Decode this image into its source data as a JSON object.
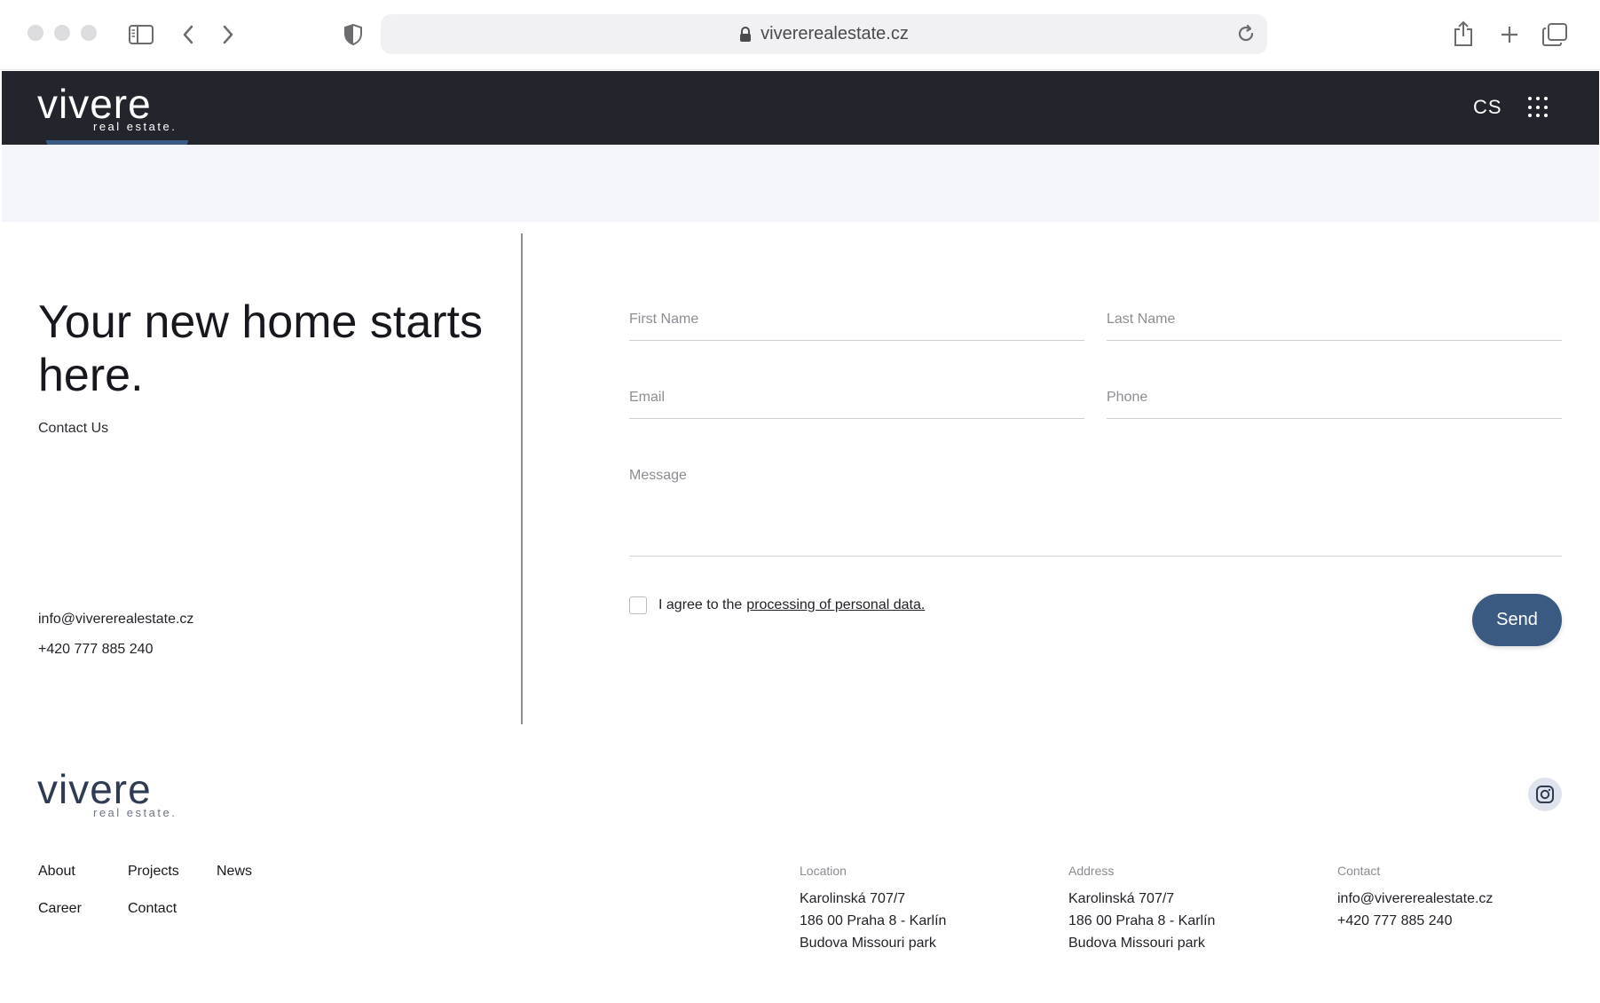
{
  "browser": {
    "url": "vivererealestate.cz"
  },
  "header": {
    "logo_main": "vivere",
    "logo_sub": "real estate.",
    "language": "CS"
  },
  "contact": {
    "headline": "Your new home starts here.",
    "subhead": "Contact Us",
    "email": "info@vivererealestate.cz",
    "phone": "+420 777 885 240"
  },
  "form": {
    "first_name_placeholder": "First Name",
    "last_name_placeholder": "Last Name",
    "email_placeholder": "Email",
    "phone_placeholder": "Phone",
    "message_placeholder": "Message",
    "consent_prefix": "I agree to the",
    "consent_link": "processing of personal data.",
    "send_label": "Send"
  },
  "footer": {
    "logo_main": "vivere",
    "logo_sub": "real estate.",
    "nav": [
      "About",
      "Projects",
      "News",
      "Career",
      "Contact"
    ],
    "location": {
      "label": "Location",
      "lines": [
        "Karolinská 707/7",
        "186 00 Praha 8 - Karlín",
        "Budova Missouri park"
      ]
    },
    "address": {
      "label": "Address",
      "lines": [
        "Karolinská 707/7",
        "186 00 Praha 8 - Karlín",
        "Budova Missouri park"
      ]
    },
    "contact": {
      "label": "Contact",
      "lines": [
        "info@vivererealestate.cz",
        "+420 777 885 240"
      ]
    }
  },
  "colors": {
    "header_bg": "#23252c",
    "accent": "#3b5a82",
    "hero_strip": "#f3f5fa"
  }
}
